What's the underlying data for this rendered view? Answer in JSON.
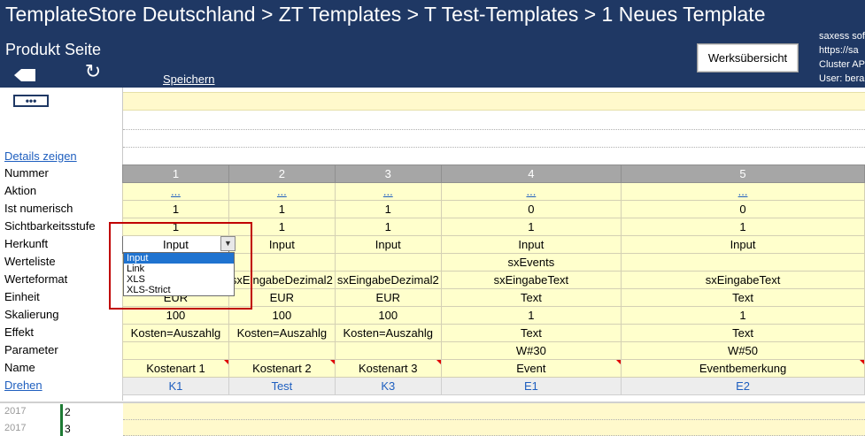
{
  "header": {
    "breadcrumb": "TemplateStore Deutschland > ZT  Templates > T  Test-Templates > 1  Neues Template",
    "subtitle": "Produkt Seite",
    "save_label": "Speichern",
    "werks_button": "Werksübersicht",
    "info": [
      "saxess sof",
      "https://sa",
      "Cluster AP",
      "User: bera"
    ],
    "refresh_icon": "↻",
    "back_icon": "back-arrow-icon"
  },
  "left": {
    "dots_label": "•••",
    "details_link": "Details zeigen"
  },
  "grid": {
    "row_labels": [
      "Nummer",
      "Aktion",
      "Ist numerisch",
      "Sichtbarkeitsstufe",
      "Herkunft",
      "Werteliste",
      "Werteformat",
      "Einheit",
      "Skalierung",
      "Effekt",
      "Parameter",
      "Name",
      "Drehen"
    ],
    "columns": [
      {
        "nummer": "1",
        "aktion": "...",
        "ist_numerisch": "1",
        "sichtbarkeit": "1",
        "herkunft": "Input",
        "werteliste": "",
        "werteformat": "sxEingabeDezimal2",
        "einheit": "EUR",
        "skalierung": "100",
        "effekt": "Kosten=Auszahlg",
        "parameter": "",
        "name": "Kostenart 1",
        "drehen": "K1"
      },
      {
        "nummer": "2",
        "aktion": "...",
        "ist_numerisch": "1",
        "sichtbarkeit": "1",
        "herkunft": "Input",
        "werteliste": "",
        "werteformat": "sxEingabeDezimal2",
        "einheit": "EUR",
        "skalierung": "100",
        "effekt": "Kosten=Auszahlg",
        "parameter": "",
        "name": "Kostenart 2",
        "drehen": "Test"
      },
      {
        "nummer": "3",
        "aktion": "...",
        "ist_numerisch": "1",
        "sichtbarkeit": "1",
        "herkunft": "Input",
        "werteliste": "",
        "werteformat": "sxEingabeDezimal2",
        "einheit": "EUR",
        "skalierung": "100",
        "effekt": "Kosten=Auszahlg",
        "parameter": "",
        "name": "Kostenart 3",
        "drehen": "K3"
      },
      {
        "nummer": "4",
        "aktion": "...",
        "ist_numerisch": "0",
        "sichtbarkeit": "1",
        "herkunft": "Input",
        "werteliste": "sxEvents",
        "werteformat": "sxEingabeText",
        "einheit": "Text",
        "skalierung": "1",
        "effekt": "Text",
        "parameter": "W#30",
        "name": "Event",
        "drehen": "E1"
      },
      {
        "nummer": "5",
        "aktion": "...",
        "ist_numerisch": "0",
        "sichtbarkeit": "1",
        "herkunft": "Input",
        "werteliste": "",
        "werteformat": "sxEingabeText",
        "einheit": "Text",
        "skalierung": "1",
        "effekt": "Text",
        "parameter": "W#50",
        "name": "Eventbemerkung",
        "drehen": "E2"
      }
    ]
  },
  "dropdown": {
    "options": [
      "Input",
      "Link",
      "XLS",
      "XLS-Strict"
    ],
    "selected": "Input",
    "arrow": "▼"
  },
  "lower": {
    "rows": [
      {
        "year": "2017",
        "num": "2"
      },
      {
        "year": "2017",
        "num": "3"
      }
    ]
  },
  "colors": {
    "header_bg": "#1f3864",
    "cell_bg": "#ffffcc",
    "link": "#1f5fbf",
    "highlight_box": "#c00000",
    "selection": "#1f73d0"
  }
}
